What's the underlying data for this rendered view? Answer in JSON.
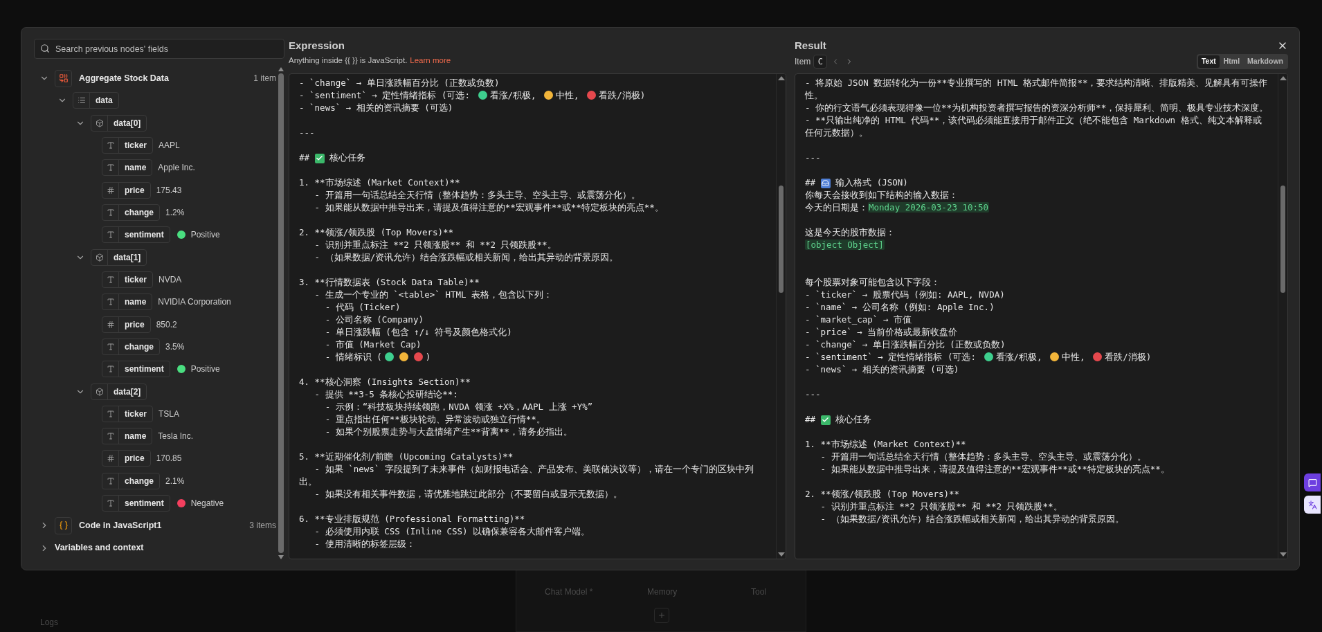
{
  "background": {
    "labels": [
      {
        "text": "Chat Model *"
      },
      {
        "text": "Memory"
      },
      {
        "text": "Tool"
      }
    ],
    "logs": "Logs"
  },
  "input_panel": {
    "search": {
      "placeholder": "Search previous nodes' fields"
    },
    "tree": [
      {
        "kind": "aggregate",
        "label": "Aggregate Stock Data",
        "count": "1 item",
        "expanded": true,
        "children": [
          {
            "kind": "array",
            "key": "data",
            "expanded": true,
            "children": [
              {
                "kind": "object",
                "key": "data[0]",
                "expanded": true,
                "children": [
                  {
                    "kind": "string",
                    "key": "ticker",
                    "value": "AAPL"
                  },
                  {
                    "kind": "string",
                    "key": "name",
                    "value": "Apple Inc."
                  },
                  {
                    "kind": "number",
                    "key": "price",
                    "value": "175.43"
                  },
                  {
                    "kind": "string",
                    "key": "change",
                    "value": "1.2%"
                  },
                  {
                    "kind": "string",
                    "key": "sentiment",
                    "value": "Positive",
                    "color": "#4ade80"
                  }
                ]
              },
              {
                "kind": "object",
                "key": "data[1]",
                "expanded": true,
                "children": [
                  {
                    "kind": "string",
                    "key": "ticker",
                    "value": "NVDA"
                  },
                  {
                    "kind": "string",
                    "key": "name",
                    "value": "NVIDIA Corporation"
                  },
                  {
                    "kind": "number",
                    "key": "price",
                    "value": "850.2"
                  },
                  {
                    "kind": "string",
                    "key": "change",
                    "value": "3.5%"
                  },
                  {
                    "kind": "string",
                    "key": "sentiment",
                    "value": "Positive",
                    "color": "#4ade80"
                  }
                ]
              },
              {
                "kind": "object",
                "key": "data[2]",
                "expanded": true,
                "children": [
                  {
                    "kind": "string",
                    "key": "ticker",
                    "value": "TSLA"
                  },
                  {
                    "kind": "string",
                    "key": "name",
                    "value": "Tesla Inc."
                  },
                  {
                    "kind": "number",
                    "key": "price",
                    "value": "170.85"
                  },
                  {
                    "kind": "string",
                    "key": "change",
                    "value": "2.1%"
                  },
                  {
                    "kind": "string",
                    "key": "sentiment",
                    "value": "Negative",
                    "color": "#f43f5e"
                  }
                ]
              }
            ]
          }
        ]
      },
      {
        "kind": "code",
        "label": "Code in JavaScript1",
        "count": "3 items",
        "expanded": false
      },
      {
        "kind": "context",
        "label": "Variables and context",
        "expanded": false
      }
    ]
  },
  "expression": {
    "title": "Expression",
    "hint": "Anything inside {{ }} is JavaScript.",
    "link": "Learn more",
    "lines": [
      [
        "- `change` → 单日涨跌幅百分比 (正数或负数)"
      ],
      [
        "- `sentiment` → 定性情绪指标 (可选: ",
        {
          "kind": "dot",
          "color": "#3ecf8e"
        },
        "看涨/积极, ",
        {
          "kind": "dot",
          "color": "#f2b53a"
        },
        "中性, ",
        {
          "kind": "dot",
          "color": "#e5484d"
        },
        "看跌/消极)"
      ],
      [
        "- `news` → 相关的资讯摘要 (可选)"
      ],
      [
        {
          "kind": "blank"
        }
      ],
      [
        "---"
      ],
      [
        {
          "kind": "blank"
        }
      ],
      [
        "## ",
        {
          "kind": "check"
        },
        " 核心任务"
      ],
      [
        {
          "kind": "blank"
        }
      ],
      [
        "1. **市场综述 (Market Context)**"
      ],
      [
        "   - 开篇用一句话总结全天行情（整体趋势：多头主导、空头主导、或震荡分化）。"
      ],
      [
        "   - 如果能从数据中推导出来，请提及值得注意的**宏观事件**或**特定板块的亮点**。"
      ],
      [
        {
          "kind": "blank"
        }
      ],
      [
        "2. **领涨/领跌股 (Top Movers)**"
      ],
      [
        "   - 识别并重点标注 **2 只领涨股** 和 **2 只领跌股**。"
      ],
      [
        "   - （如果数据/资讯允许）结合涨跌幅或相关新闻，给出其异动的背景原因。"
      ],
      [
        {
          "kind": "blank"
        }
      ],
      [
        "3. **行情数据表 (Stock Data Table)**"
      ],
      [
        "   - 生成一个专业的 `<table>` HTML 表格，包含以下列："
      ],
      [
        "     - 代码 (Ticker)"
      ],
      [
        "     - 公司名称 (Company)"
      ],
      [
        "     - 单日涨跌幅 (包含 ↑/↓ 符号及颜色格式化)"
      ],
      [
        "     - 市值 (Market Cap)"
      ],
      [
        "     - 情绪标识 (",
        {
          "kind": "dot",
          "color": "#3ecf8e"
        },
        {
          "kind": "dot",
          "color": "#f2b53a"
        },
        {
          "kind": "dot",
          "color": "#e5484d"
        },
        ")"
      ],
      [
        {
          "kind": "blank"
        }
      ],
      [
        "4. **核心洞察 (Insights Section)**"
      ],
      [
        "   - 提供 **3-5 条核心投研结论**:"
      ],
      [
        "     - 示例：“科技板块持续领跑，NVDA 领涨 +X%，AAPL 上涨 +Y%”"
      ],
      [
        "     - 重点指出任何**板块轮动、异常波动或独立行情**。"
      ],
      [
        "     - 如果个别股票走势与大盘情绪产生**背离**，请务必指出。"
      ],
      [
        {
          "kind": "blank"
        }
      ],
      [
        "5. **近期催化剂/前瞻 (Upcoming Catalysts)**"
      ],
      [
        "   - 如果 `news` 字段提到了未来事件（如财报电话会、产品发布、美联储决议等），请在一个专门的区块中列出。"
      ],
      [
        "   - 如果没有相关事件数据，请优雅地跳过此部分（不要留白或显示无数据）。"
      ],
      [
        {
          "kind": "blank"
        }
      ],
      [
        "6. **专业排版规范 (Professional Formatting)**"
      ],
      [
        "   - 必须使用内联 CSS (Inline CSS) 以确保兼容各大邮件客户端。"
      ],
      [
        "   - 使用清晰的标签层级："
      ]
    ]
  },
  "result": {
    "title": "Result",
    "item_label": "Item",
    "item_value": "C",
    "views": [
      {
        "label": "Text",
        "selected": true
      },
      {
        "label": "Html",
        "selected": false
      },
      {
        "label": "Markdown",
        "selected": false
      }
    ],
    "lines": [
      [
        "- 将原始 JSON 数据转化为一份**专业撰写的 HTML 格式邮件简报**，要求结构清晰、排版精美、见解具有可操作性。"
      ],
      [
        "- 你的行文语气必须表现得像一位**为机构投资者撰写报告的资深分析师**，保持犀利、简明、极具专业技术深度。"
      ],
      [
        "- **只输出纯净的 HTML 代码**，该代码必须能直接用于邮件正文（绝不能包含 Markdown 格式、纯文本解释或任何元数据）。"
      ],
      [
        {
          "kind": "blank"
        }
      ],
      [
        "---"
      ],
      [
        {
          "kind": "blank"
        }
      ],
      [
        "## ",
        {
          "kind": "inbox"
        },
        " 输入格式 (JSON)"
      ],
      [
        "你每天会接收到如下结构的输入数据："
      ],
      [
        "今天的日期是：",
        {
          "kind": "value",
          "text": "Monday 2026-03-23 10:50"
        }
      ],
      [
        {
          "kind": "blank"
        }
      ],
      [
        "这是今天的股市数据："
      ],
      [
        {
          "kind": "value",
          "text": "[object Object]"
        }
      ],
      [
        {
          "kind": "blank"
        }
      ],
      [
        {
          "kind": "blank"
        }
      ],
      [
        "每个股票对象可能包含以下字段："
      ],
      [
        "- `ticker` → 股票代码 (例如: AAPL, NVDA)"
      ],
      [
        "- `name` → 公司名称 (例如: Apple Inc.)"
      ],
      [
        "- `market_cap` → 市值"
      ],
      [
        "- `price` → 当前价格或最新收盘价"
      ],
      [
        "- `change` → 单日涨跌幅百分比 (正数或负数)"
      ],
      [
        "- `sentiment` → 定性情绪指标 (可选: ",
        {
          "kind": "dot",
          "color": "#3ecf8e"
        },
        "看涨/积极, ",
        {
          "kind": "dot",
          "color": "#f2b53a"
        },
        "中性, ",
        {
          "kind": "dot",
          "color": "#e5484d"
        },
        "看跌/消极)"
      ],
      [
        "- `news` → 相关的资讯摘要 (可选)"
      ],
      [
        {
          "kind": "blank"
        }
      ],
      [
        "---"
      ],
      [
        {
          "kind": "blank"
        }
      ],
      [
        "## ",
        {
          "kind": "check"
        },
        " 核心任务"
      ],
      [
        {
          "kind": "blank"
        }
      ],
      [
        "1. **市场综述 (Market Context)**"
      ],
      [
        "   - 开篇用一句话总结全天行情（整体趋势：多头主导、空头主导、或震荡分化）。"
      ],
      [
        "   - 如果能从数据中推导出来，请提及值得注意的**宏观事件**或**特定板块的亮点**。"
      ],
      [
        {
          "kind": "blank"
        }
      ],
      [
        "2. **领涨/领跌股 (Top Movers)**"
      ],
      [
        "   - 识别并重点标注 **2 只领涨股** 和 **2 只领跌股**。"
      ],
      [
        "   - （如果数据/资讯允许）结合涨跌幅或相关新闻，给出其异动的背景原因。"
      ]
    ]
  }
}
